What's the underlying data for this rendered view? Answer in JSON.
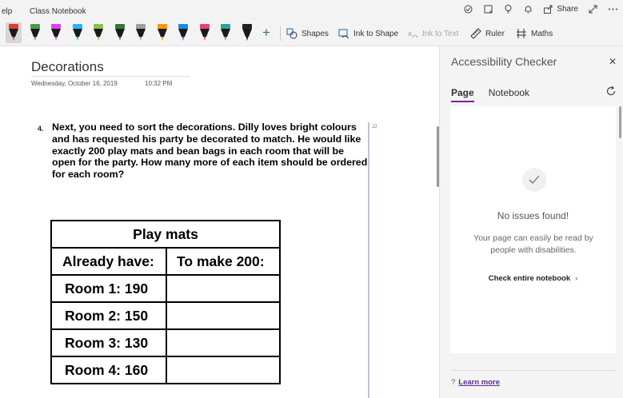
{
  "titlebar": {
    "help": "elp",
    "notebook": "Class Notebook",
    "share_label": "Share"
  },
  "ribbon": {
    "pens": [
      {
        "name": "pen-red",
        "color": "#e53935"
      },
      {
        "name": "pen-green",
        "color": "#43a047"
      },
      {
        "name": "pen-magenta",
        "color": "#e040fb"
      },
      {
        "name": "pen-cyan",
        "color": "#29b6f6"
      },
      {
        "name": "pen-lime",
        "color": "#8bc34a"
      },
      {
        "name": "pen-green-dark",
        "color": "#2e7d32"
      },
      {
        "name": "pen-gray",
        "color": "#9e9e9e"
      },
      {
        "name": "pen-galaxy",
        "color": "#ff9800"
      },
      {
        "name": "pen-blue-rainbow",
        "color": "#1e88e5"
      },
      {
        "name": "pen-pink",
        "color": "#ec407a"
      },
      {
        "name": "pen-teal",
        "color": "#26a69a"
      },
      {
        "name": "pen-black",
        "color": "#212121"
      }
    ],
    "shapes": "Shapes",
    "ink_to_shape": "Ink to Shape",
    "ink_to_text": "Ink to Text",
    "ruler": "Ruler",
    "maths": "Maths"
  },
  "page": {
    "title": "Decorations",
    "date": "Wednesday, October 16, 2019",
    "time": "10:32 PM",
    "question_number": "4.",
    "question": "Next, you need to sort the decorations. Dilly loves bright colours and has requested his party be decorated to match. He would like exactly 200 play mats and bean bags in each room that will be open for the party. How many more of each item should be ordered for each room?",
    "marker": "JJ",
    "table": {
      "title": "Play mats",
      "headers": [
        "Already have:",
        "To make 200:"
      ],
      "rows": [
        [
          "Room 1: 190",
          ""
        ],
        [
          "Room 2: 150",
          ""
        ],
        [
          "Room 3: 130",
          ""
        ],
        [
          "Room 4: 160",
          ""
        ]
      ]
    }
  },
  "panel": {
    "title": "Accessibility Checker",
    "tabs": [
      "Page",
      "Notebook"
    ],
    "status": "No issues found!",
    "description": "Your page can easily be read by people with disabilities.",
    "check_link": "Check entire notebook",
    "help_mark": "?",
    "learn_more": "Learn more"
  }
}
